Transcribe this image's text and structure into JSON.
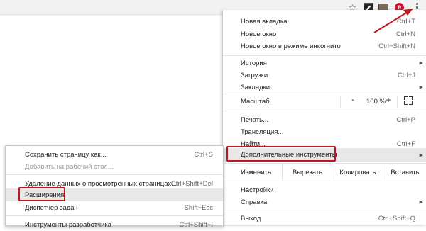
{
  "toolbar": {
    "icons": [
      "star-icon",
      "extension-icon",
      "monitor-extension-icon",
      "adblock-e-icon",
      "menu-dots-icon"
    ],
    "accent": "#d40f2c",
    "adblock_letter": "e"
  },
  "menu": {
    "new_tab": {
      "label": "Новая вкладка",
      "shortcut": "Ctrl+T"
    },
    "new_window": {
      "label": "Новое окно",
      "shortcut": "Ctrl+N"
    },
    "incognito": {
      "label": "Новое окно в режиме инкогнито",
      "shortcut": "Ctrl+Shift+N"
    },
    "history": {
      "label": "История"
    },
    "downloads": {
      "label": "Загрузки",
      "shortcut": "Ctrl+J"
    },
    "bookmarks": {
      "label": "Закладки"
    },
    "zoom": {
      "label": "Масштаб",
      "minus": "-",
      "value": "100 %",
      "plus": "+"
    },
    "print": {
      "label": "Печать...",
      "shortcut": "Ctrl+P"
    },
    "cast": {
      "label": "Трансляция..."
    },
    "find": {
      "label": "Найти...",
      "shortcut": "Ctrl+F"
    },
    "more_tools": {
      "label": "Дополнительные инструменты"
    },
    "edit": {
      "label": "Изменить",
      "cut": "Вырезать",
      "copy": "Копировать",
      "paste": "Вставить"
    },
    "settings": {
      "label": "Настройки"
    },
    "help": {
      "label": "Справка"
    },
    "exit": {
      "label": "Выход",
      "shortcut": "Ctrl+Shift+Q"
    }
  },
  "submenu": {
    "save_page": {
      "label": "Сохранить страницу как...",
      "shortcut": "Ctrl+S"
    },
    "add_desktop": {
      "label": "Добавить на рабочий стол..."
    },
    "clear_data": {
      "label": "Удаление данных о просмотренных страницах...",
      "shortcut": "Ctrl+Shift+Del"
    },
    "extensions": {
      "label": "Расширения"
    },
    "task_manager": {
      "label": "Диспетчер задач",
      "shortcut": "Shift+Esc"
    },
    "dev_tools": {
      "label": "Инструменты разработчика",
      "shortcut": "Ctrl+Shift+I"
    }
  },
  "colors": {
    "highlight_box": "#c0161f",
    "hover_bg": "#e8e8e8"
  }
}
